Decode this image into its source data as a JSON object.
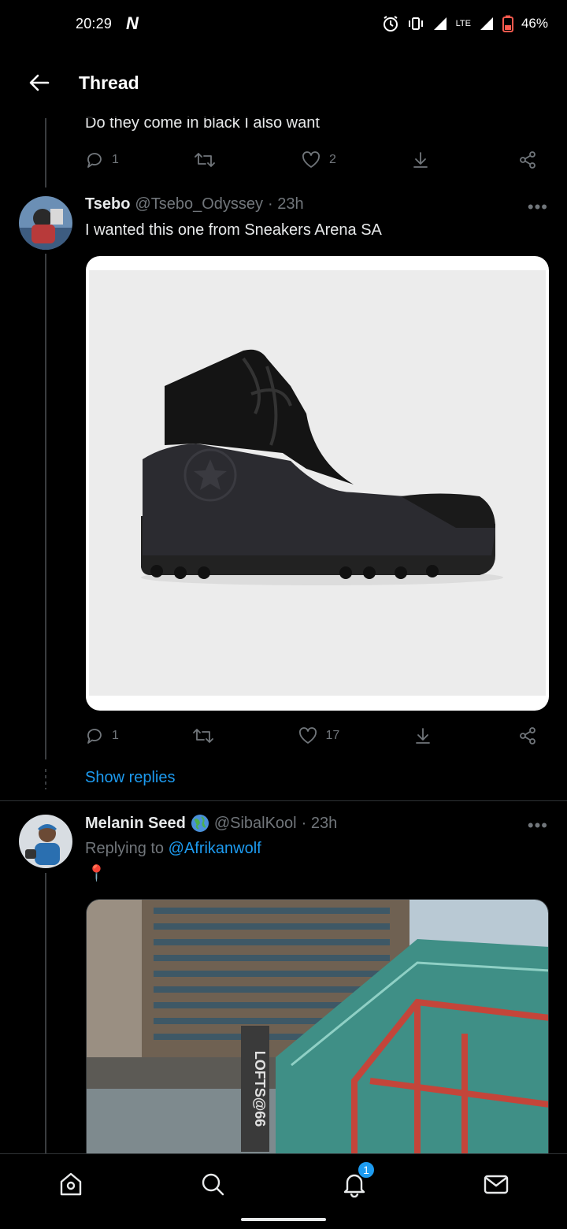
{
  "status_bar": {
    "time": "20:29",
    "app_glyph": "N",
    "battery": "46%",
    "network": "LTE"
  },
  "header": {
    "title": "Thread"
  },
  "tweet0": {
    "text": "Do they come in black I also want",
    "replies": "1",
    "likes": "2"
  },
  "tweet1": {
    "name": "Tsebo",
    "handle": "@Tsebo_Odyssey",
    "time": "· 23h",
    "text": "I wanted this one from Sneakers Arena SA",
    "replies": "1",
    "likes": "17",
    "show_replies": "Show replies"
  },
  "tweet2": {
    "name": "Melanin Seed",
    "handle": "@SibalKool",
    "time": "· 23h",
    "replying_prefix": "Replying to",
    "replying_to": "@Afrikanwolf",
    "emoji": "📍",
    "image_sign": "LOFTS@66"
  },
  "more_glyph": "•••",
  "bottom_nav": {
    "notifications_badge": "1"
  },
  "colors": {
    "accent": "#1d9bf0",
    "background": "#000000",
    "muted": "#71767b"
  }
}
